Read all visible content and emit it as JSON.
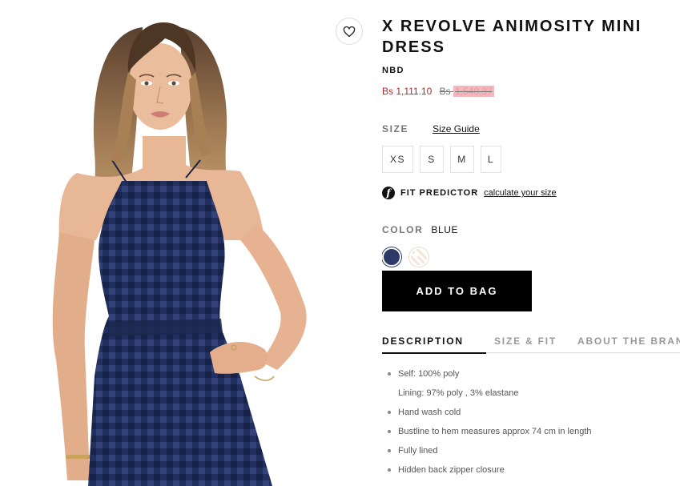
{
  "product": {
    "title": "X REVOLVE ANIMOSITY MINI DRESS",
    "brand": "NBD",
    "sale_price": "Bs 1,111.10",
    "original_price_currency": "Bs",
    "original_price_amount": "1,540.37"
  },
  "size": {
    "label": "SIZE",
    "guide_link": "Size Guide",
    "options": [
      "XS",
      "S",
      "M",
      "L"
    ]
  },
  "fit_predictor": {
    "logo_glyph": "f",
    "label": "FIT PREDICTOR",
    "link": "calculate your size"
  },
  "color": {
    "label": "COLOR",
    "selected": "BLUE",
    "swatches": [
      {
        "name": "blue",
        "hex": "#2c3a68"
      },
      {
        "name": "cream",
        "hex": "#f5e6dc"
      }
    ]
  },
  "add_to_bag_label": "ADD TO BAG",
  "tabs": [
    {
      "label": "DESCRIPTION",
      "active": true
    },
    {
      "label": "SIZE & FIT",
      "active": false
    },
    {
      "label": "ABOUT THE BRAND",
      "active": false
    }
  ],
  "description": [
    {
      "text": "Self: 100% poly",
      "bullet": true
    },
    {
      "text": "Lining: 97% poly , 3% elastane",
      "bullet": false
    },
    {
      "text": "Hand wash cold",
      "bullet": true
    },
    {
      "text": "Bustline to hem measures approx 74 cm in length",
      "bullet": true
    },
    {
      "text": "Fully lined",
      "bullet": true
    },
    {
      "text": "Hidden back zipper closure",
      "bullet": true
    }
  ],
  "colors": {
    "sale_price": "#b3292e",
    "dress_navy": "#2c3a68",
    "button_black": "#000000"
  },
  "icons": {
    "wishlist": "heart-outline-icon",
    "fit_predictor": "fit-predictor-logo-icon"
  }
}
